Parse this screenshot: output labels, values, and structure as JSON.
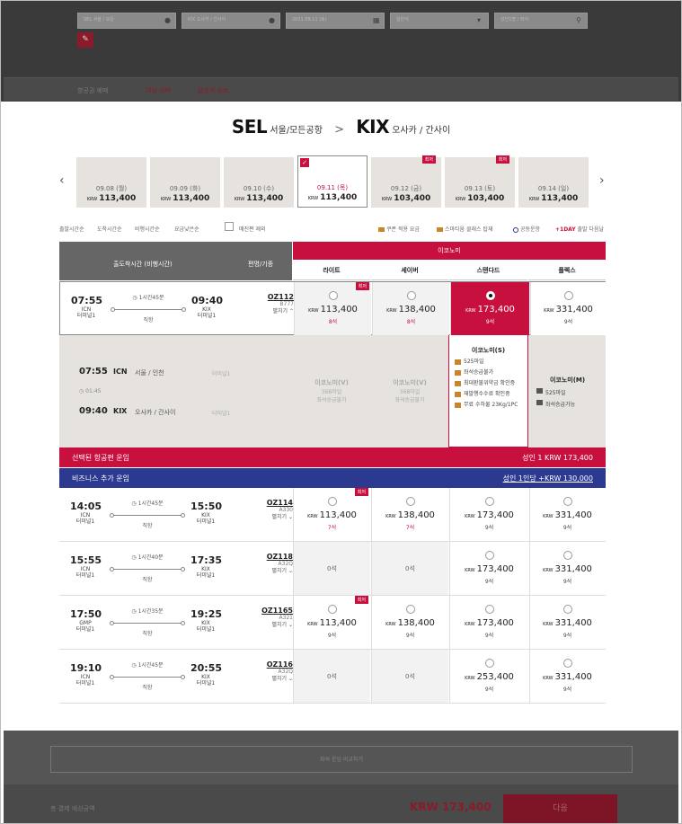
{
  "search": {
    "from_placeholder": "SEL 서울 / 모든",
    "to_placeholder": "KIX 오사카 / 간사이",
    "date_placeholder": "2021.09.11 (토)",
    "class_placeholder": "일반석",
    "pax_placeholder": "성인1명 / 좌석"
  },
  "breadcrumb": {
    "title": "항공권 예매",
    "step1": "여정 선택",
    "step2": "탑승객 정보"
  },
  "route": {
    "from_code": "SEL",
    "from_name": "서울/모든공항",
    "arrow": ">",
    "to_code": "KIX",
    "to_name": "오사카 / 간사이"
  },
  "dates": [
    {
      "date": "09.08 (월)",
      "cur": "KRW",
      "price": "113,400",
      "badge": ""
    },
    {
      "date": "09.09 (화)",
      "cur": "KRW",
      "price": "113,400",
      "badge": ""
    },
    {
      "date": "09.10 (수)",
      "cur": "KRW",
      "price": "113,400",
      "badge": ""
    },
    {
      "date": "09.11 (목)",
      "cur": "KRW",
      "price": "113,400",
      "badge": "",
      "check": "✓"
    },
    {
      "date": "09.12 (금)",
      "cur": "KRW",
      "price": "103,400",
      "badge": "최저"
    },
    {
      "date": "09.13 (토)",
      "cur": "KRW",
      "price": "103,400",
      "badge": "최저"
    },
    {
      "date": "09.14 (일)",
      "cur": "KRW",
      "price": "113,400",
      "badge": ""
    }
  ],
  "nav": {
    "prev": "‹",
    "next": "›"
  },
  "sort": {
    "dep": "출발시간순",
    "arr": "도착시간순",
    "dur": "비행시간순",
    "fare": "요금낮은순",
    "exclude": "매진편 제외"
  },
  "legend": {
    "coupon": "쿠폰 적용 요금",
    "smarium": "스마티움 클래스 탑재",
    "codeshare": "공동운항",
    "oneday_tag": "+1DAY",
    "oneday": "출발 다음날"
  },
  "table": {
    "col_time": "출도착시간 (비행시간)",
    "col_flight": "편명/기종",
    "cabin": "이코노미",
    "fares": [
      "라이트",
      "세이버",
      "스탠다드",
      "플렉스"
    ]
  },
  "flights": [
    {
      "dep": "07:55",
      "dep_ap": "ICN",
      "dep_tm": "터미널1",
      "dur": "1시간45분",
      "stop": "직항",
      "arr": "09:40",
      "arr_ap": "KIX",
      "arr_tm": "터미널1",
      "no": "OZ112",
      "ac": "B777",
      "tog": "펼치기",
      "cells": [
        {
          "p": "113,400",
          "s": "8석",
          "hot": "최저"
        },
        {
          "p": "138,400",
          "s": "8석"
        },
        {
          "p": "173,400",
          "s": "9석"
        },
        {
          "p": "331,400",
          "s": "9석"
        }
      ]
    }
  ],
  "detail": {
    "dep_time": "07:55",
    "dep_code": "ICN",
    "dep_city": "서울 / 인천",
    "dep_tm": "터미널1",
    "dur": "01:45",
    "arr_time": "09:40",
    "arr_code": "KIX",
    "arr_city": "오사카 / 간사이",
    "arr_tm": "터미널1",
    "light": {
      "name": "이코노미(V)",
      "mile": "368마일",
      "up": "좌석승급불가"
    },
    "saver": {
      "name": "이코노미(V)",
      "mile": "368마일",
      "up": "좌석승급불가"
    },
    "std": {
      "name": "이코노미(S)",
      "mile": "525마일",
      "up": "좌석승급불가",
      "refund": "최대환불위약금 확인중",
      "change": "재발행수수료 확인중",
      "bag": "무료 수하물 23Kg/1PC"
    },
    "flex": {
      "name": "이코노미(M)",
      "mile": "525마일",
      "up": "좌석승급가능"
    }
  },
  "selected_bar": {
    "label": "선택된 항공편 운임",
    "value": "성인 1 KRW 173,400"
  },
  "biz_bar": {
    "label": "비즈니스 추가 운임",
    "value": "성인 1인당 +KRW 130,000"
  },
  "rows": [
    {
      "dep": "14:05",
      "dep_ap": "ICN",
      "dep_tm": "터미널1",
      "dur": "1시간45분",
      "stop": "직항",
      "arr": "15:50",
      "arr_ap": "KIX",
      "arr_tm": "터미널1",
      "no": "OZ114",
      "ac": "A330",
      "tog": "펼치기",
      "c": [
        {
          "t": "p",
          "p": "113,400",
          "s": "7석",
          "hot": "최저",
          "red": true
        },
        {
          "t": "p",
          "p": "138,400",
          "s": "7석",
          "red": true
        },
        {
          "t": "p",
          "p": "173,400",
          "s": "9석"
        },
        {
          "t": "p",
          "p": "331,400",
          "s": "9석"
        }
      ]
    },
    {
      "dep": "15:55",
      "dep_ap": "ICN",
      "dep_tm": "터미널1",
      "dur": "1시간40분",
      "stop": "직항",
      "arr": "17:35",
      "arr_ap": "KIX",
      "arr_tm": "터미널1",
      "no": "OZ118",
      "ac": "A32Q",
      "tog": "펼치기",
      "c": [
        {
          "t": "z",
          "s": "0석"
        },
        {
          "t": "z",
          "s": "0석"
        },
        {
          "t": "p",
          "p": "173,400",
          "s": "9석"
        },
        {
          "t": "p",
          "p": "331,400",
          "s": "9석"
        }
      ]
    },
    {
      "dep": "17:50",
      "dep_ap": "GMP",
      "dep_tm": "터미널1",
      "dur": "1시간35분",
      "stop": "직항",
      "arr": "19:25",
      "arr_ap": "KIX",
      "arr_tm": "터미널1",
      "no": "OZ1165",
      "ac": "A321",
      "tog": "펼치기",
      "c": [
        {
          "t": "p",
          "p": "113,400",
          "s": "9석",
          "hot": "최저"
        },
        {
          "t": "p",
          "p": "138,400",
          "s": "9석"
        },
        {
          "t": "p",
          "p": "173,400",
          "s": "9석"
        },
        {
          "t": "p",
          "p": "331,400",
          "s": "9석"
        }
      ]
    },
    {
      "dep": "19:10",
      "dep_ap": "ICN",
      "dep_tm": "터미널1",
      "dur": "1시간45분",
      "stop": "직항",
      "arr": "20:55",
      "arr_ap": "KIX",
      "arr_tm": "터미널1",
      "no": "OZ116",
      "ac": "A32Q",
      "tog": "펼치기",
      "c": [
        {
          "t": "z",
          "s": "0석"
        },
        {
          "t": "z",
          "s": "0석"
        },
        {
          "t": "p",
          "p": "253,400",
          "s": "9석"
        },
        {
          "t": "p",
          "p": "331,400",
          "s": "9석"
        }
      ]
    }
  ],
  "currency": "KRW",
  "footer": {
    "compare": "좌석 운임 비교하기",
    "total_label": "총 결제 예상금액",
    "total": "KRW 173,400",
    "next": "다음"
  },
  "colors": {
    "brand": "#c8103e",
    "biz": "#2b3990",
    "dark": "#666666"
  }
}
